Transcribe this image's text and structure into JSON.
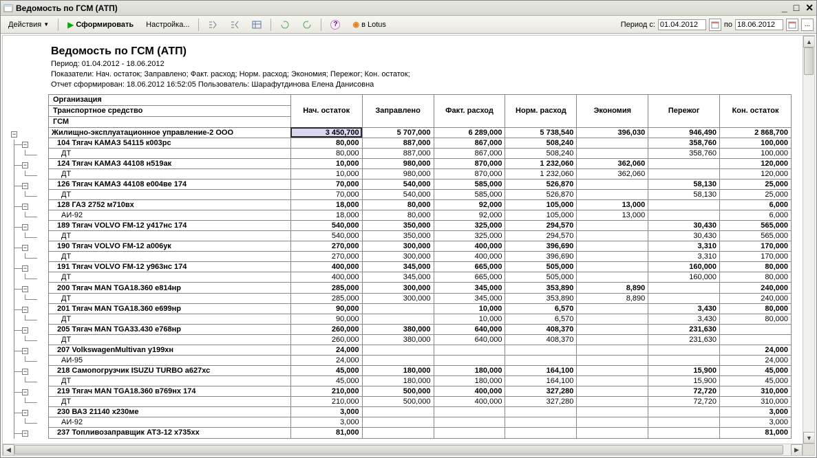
{
  "window": {
    "title": "Ведомость по ГСМ (АТП)"
  },
  "toolbar": {
    "actions_label": "Действия",
    "generate_label": "Сформировать",
    "settings_label": "Настройка...",
    "lotus_label": "в Lotus",
    "period_label": "Период с:",
    "date_from": "01.04.2012",
    "date_to_label": "по",
    "date_to": "18.06.2012",
    "more": "..."
  },
  "report": {
    "title": "Ведомость по ГСМ (АТП)",
    "period_line": "Период: 01.04.2012 - 18.06.2012",
    "indicators_line": "Показатели: Нач. остаток; Заправлено; Факт. расход; Норм. расход; Экономия; Пережог; Кон. остаток;",
    "generated_line": "Отчет сформирован: 18.06.2012 16:52:05 Пользователь: Шарафутдинова Елена Данисовна"
  },
  "columns": {
    "org": "Организация",
    "vehicle": "Транспортное средство",
    "fuel": "ГСМ",
    "c1": "Нач. остаток",
    "c2": "Заправлено",
    "c3": "Факт. расход",
    "c4": "Норм. расход",
    "c5": "Экономия",
    "c6": "Пережог",
    "c7": "Кон. остаток"
  },
  "rows": [
    {
      "type": "org",
      "name": "Жилищно-эксплуатационное управление-2 ООО",
      "v": [
        "3 450,700",
        "5 707,000",
        "6 289,000",
        "5 738,540",
        "396,030",
        "946,490",
        "2 868,700"
      ],
      "sel": 0
    },
    {
      "type": "vehicle",
      "name": "104 Тягач КАМАЗ 54115 к003рс",
      "v": [
        "80,000",
        "887,000",
        "867,000",
        "508,240",
        "",
        "358,760",
        "100,000"
      ]
    },
    {
      "type": "fuel",
      "name": "ДТ",
      "v": [
        "80,000",
        "887,000",
        "867,000",
        "508,240",
        "",
        "358,760",
        "100,000"
      ]
    },
    {
      "type": "vehicle",
      "name": "124 Тягач КАМАЗ 44108 н519ак",
      "v": [
        "10,000",
        "980,000",
        "870,000",
        "1 232,060",
        "362,060",
        "",
        "120,000"
      ]
    },
    {
      "type": "fuel",
      "name": "ДТ",
      "v": [
        "10,000",
        "980,000",
        "870,000",
        "1 232,060",
        "362,060",
        "",
        "120,000"
      ]
    },
    {
      "type": "vehicle",
      "name": "126 Тягач КАМАЗ 44108 е004ве 174",
      "v": [
        "70,000",
        "540,000",
        "585,000",
        "526,870",
        "",
        "58,130",
        "25,000"
      ]
    },
    {
      "type": "fuel",
      "name": "ДТ",
      "v": [
        "70,000",
        "540,000",
        "585,000",
        "526,870",
        "",
        "58,130",
        "25,000"
      ]
    },
    {
      "type": "vehicle",
      "name": "128 ГАЗ 2752 м710вх",
      "v": [
        "18,000",
        "80,000",
        "92,000",
        "105,000",
        "13,000",
        "",
        "6,000"
      ]
    },
    {
      "type": "fuel",
      "name": "АИ-92",
      "v": [
        "18,000",
        "80,000",
        "92,000",
        "105,000",
        "13,000",
        "",
        "6,000"
      ]
    },
    {
      "type": "vehicle",
      "name": "189 Тягач VOLVO FM-12 у417нс 174",
      "v": [
        "540,000",
        "350,000",
        "325,000",
        "294,570",
        "",
        "30,430",
        "565,000"
      ]
    },
    {
      "type": "fuel",
      "name": "ДТ",
      "v": [
        "540,000",
        "350,000",
        "325,000",
        "294,570",
        "",
        "30,430",
        "565,000"
      ]
    },
    {
      "type": "vehicle",
      "name": "190 Тягач VOLVO FM-12 а006ук",
      "v": [
        "270,000",
        "300,000",
        "400,000",
        "396,690",
        "",
        "3,310",
        "170,000"
      ]
    },
    {
      "type": "fuel",
      "name": "ДТ",
      "v": [
        "270,000",
        "300,000",
        "400,000",
        "396,690",
        "",
        "3,310",
        "170,000"
      ]
    },
    {
      "type": "vehicle",
      "name": "191 Тягач VOLVO FM-12 у963нс 174",
      "v": [
        "400,000",
        "345,000",
        "665,000",
        "505,000",
        "",
        "160,000",
        "80,000"
      ]
    },
    {
      "type": "fuel",
      "name": "ДТ",
      "v": [
        "400,000",
        "345,000",
        "665,000",
        "505,000",
        "",
        "160,000",
        "80,000"
      ]
    },
    {
      "type": "vehicle",
      "name": "200 Тягач MAN TGA18.360 е814нр",
      "v": [
        "285,000",
        "300,000",
        "345,000",
        "353,890",
        "8,890",
        "",
        "240,000"
      ]
    },
    {
      "type": "fuel",
      "name": "ДТ",
      "v": [
        "285,000",
        "300,000",
        "345,000",
        "353,890",
        "8,890",
        "",
        "240,000"
      ]
    },
    {
      "type": "vehicle",
      "name": "201 Тягач MAN TGA18.360 е699нр",
      "v": [
        "90,000",
        "",
        "10,000",
        "6,570",
        "",
        "3,430",
        "80,000"
      ]
    },
    {
      "type": "fuel",
      "name": "ДТ",
      "v": [
        "90,000",
        "",
        "10,000",
        "6,570",
        "",
        "3,430",
        "80,000"
      ]
    },
    {
      "type": "vehicle",
      "name": "205 Тягач MAN TGA33.430 е768нр",
      "v": [
        "260,000",
        "380,000",
        "640,000",
        "408,370",
        "",
        "231,630",
        ""
      ]
    },
    {
      "type": "fuel",
      "name": "ДТ",
      "v": [
        "260,000",
        "380,000",
        "640,000",
        "408,370",
        "",
        "231,630",
        ""
      ]
    },
    {
      "type": "vehicle",
      "name": "207 VolkswagenMultivan у199хн",
      "v": [
        "24,000",
        "",
        "",
        "",
        "",
        "",
        "24,000"
      ]
    },
    {
      "type": "fuel",
      "name": "АИ-95",
      "v": [
        "24,000",
        "",
        "",
        "",
        "",
        "",
        "24,000"
      ]
    },
    {
      "type": "vehicle",
      "name": "218 Самопогрузчик ISUZU TURBO а627хс",
      "v": [
        "45,000",
        "180,000",
        "180,000",
        "164,100",
        "",
        "15,900",
        "45,000"
      ]
    },
    {
      "type": "fuel",
      "name": "ДТ",
      "v": [
        "45,000",
        "180,000",
        "180,000",
        "164,100",
        "",
        "15,900",
        "45,000"
      ]
    },
    {
      "type": "vehicle",
      "name": "219 Тягач MAN TGA18.360 в769нх 174",
      "v": [
        "210,000",
        "500,000",
        "400,000",
        "327,280",
        "",
        "72,720",
        "310,000"
      ]
    },
    {
      "type": "fuel",
      "name": "ДТ",
      "v": [
        "210,000",
        "500,000",
        "400,000",
        "327,280",
        "",
        "72,720",
        "310,000"
      ]
    },
    {
      "type": "vehicle",
      "name": "230 ВАЗ 21140 х230ме",
      "v": [
        "3,000",
        "",
        "",
        "",
        "",
        "",
        "3,000"
      ]
    },
    {
      "type": "fuel",
      "name": "АИ-92",
      "v": [
        "3,000",
        "",
        "",
        "",
        "",
        "",
        "3,000"
      ]
    },
    {
      "type": "vehicle",
      "name": "237 Топливозаправщик АТЗ-12 х735хх",
      "v": [
        "81,000",
        "",
        "",
        "",
        "",
        "",
        "81,000"
      ]
    }
  ]
}
